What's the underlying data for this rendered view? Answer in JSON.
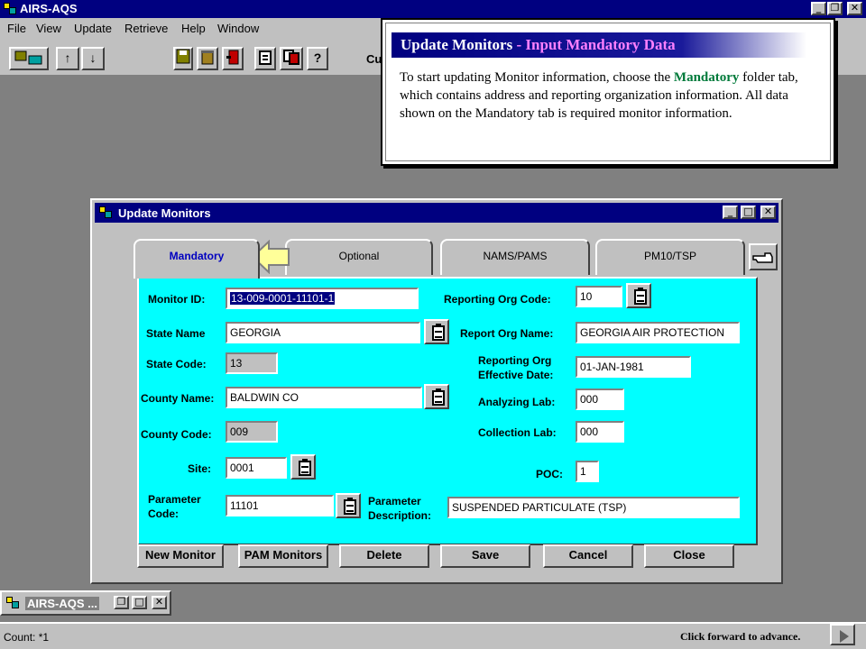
{
  "app": {
    "title": "AIRS-AQS",
    "controls": {
      "minimize": "_",
      "restore": "❐",
      "close": "✕"
    }
  },
  "menu": [
    "File",
    "View",
    "Update",
    "Retrieve",
    "Help",
    "Window"
  ],
  "toolbar": {
    "up_arrow": "↑",
    "down_arrow": "↓",
    "help_query": "?",
    "partial_text": "Cu"
  },
  "help": {
    "title_main": "Update Monitors",
    "title_sep": " - ",
    "title_sub": "Input Mandatory Data",
    "body_pre": "To start updating Monitor information, choose the ",
    "body_hl": "Mandatory",
    "body_post": " folder tab, which contains address and reporting organization information.  All data shown on the Mandatory tab is required monitor information."
  },
  "window": {
    "title": "Update Monitors",
    "tabs": [
      "Mandatory",
      "Optional",
      "NAMS/PAMS",
      "PM10/TSP"
    ],
    "form": {
      "monitor_id_label": "Monitor ID:",
      "monitor_id": "13-009-0001-11101-1",
      "state_name_label": "State Name",
      "state_name": "GEORGIA",
      "state_code_label": "State Code:",
      "state_code": "13",
      "county_name_label": "County Name:",
      "county_name": "BALDWIN CO",
      "county_code_label": "County Code:",
      "county_code": "009",
      "site_label": "Site:",
      "site": "0001",
      "param_code_label_1": "Parameter",
      "param_code_label_2": "Code:",
      "param_code": "11101",
      "rep_org_code_label": "Reporting Org Code:",
      "rep_org_code": "10",
      "rep_org_name_label": "Report Org Name:",
      "rep_org_name": "GEORGIA AIR PROTECTION",
      "rep_org_eff_label_1": "Reporting Org",
      "rep_org_eff_label_2": "Effective Date:",
      "rep_org_eff": "01-JAN-1981",
      "analyzing_lab_label": "Analyzing Lab:",
      "analyzing_lab": "000",
      "collection_lab_label": "Collection Lab:",
      "collection_lab": "000",
      "poc_label": "POC:",
      "poc": "1",
      "param_desc_label_1": "Parameter",
      "param_desc_label_2": "Description:",
      "param_desc": "SUSPENDED PARTICULATE (TSP)"
    },
    "buttons": [
      "New Monitor",
      "PAM Monitors",
      "Delete",
      "Save",
      "Cancel",
      "Close"
    ]
  },
  "minimized": {
    "title": "AIRS-AQS ..."
  },
  "status": {
    "count": "Count: *1",
    "advance": "Click forward to advance."
  }
}
